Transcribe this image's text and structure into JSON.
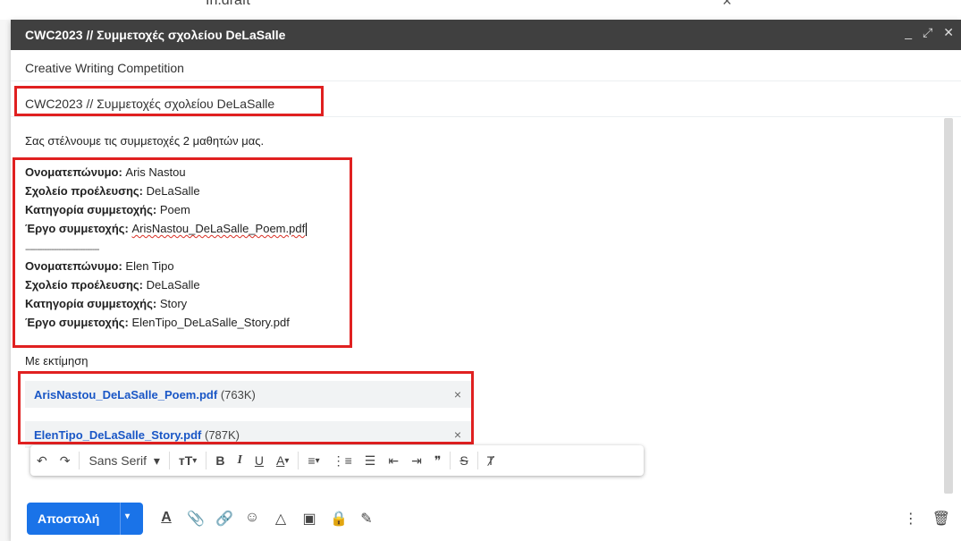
{
  "topstrip": {
    "fragment": "In.draft"
  },
  "window": {
    "title": "CWC2023 // Συμμετοχές σχολείου DeLaSalle",
    "minimize": "_",
    "expand": "⤢",
    "close": "✕"
  },
  "recipient": "Creative Writing Competition",
  "subject": "CWC2023 // Συμμετοχές σχολείου DeLaSalle",
  "body": {
    "intro": "Σας στέλνουμε τις συμμετοχές 2 μαθητών μας.",
    "entries": [
      {
        "name_label": "Ονοματεπώνυμο:",
        "name": "Aris Nastou",
        "school_label": "Σχολείο προέλευσης:",
        "school": "DeLaSalle",
        "category_label": "Κατηγορία συμμετοχής:",
        "category": "Poem",
        "work_label": "Έργο συμμετοχής:",
        "work": "ArisNastou_DeLaSalle_Poem.pdf"
      },
      {
        "name_label": "Ονοματεπώνυμο:",
        "name": "Elen Tipo",
        "school_label": "Σχολείο προέλευσης:",
        "school": "DeLaSalle",
        "category_label": "Κατηγορία συμμετοχής:",
        "category": "Story",
        "work_label": "Έργο συμμετοχής:",
        "work": "ElenTipo_DeLaSalle_Story.pdf"
      }
    ],
    "separator": "-------------------------------",
    "closing": "Με εκτίμηση"
  },
  "attachments": [
    {
      "name": "ArisNastou_DeLaSalle_Poem.pdf",
      "size": "(763K)",
      "remove": "×"
    },
    {
      "name": "ElenTipo_DeLaSalle_Story.pdf",
      "size": "(787K)",
      "remove": "×"
    }
  ],
  "toolbar": {
    "undo": "↶",
    "redo": "↷",
    "font": "Sans Serif",
    "font_caret": "▾",
    "size": "ᴛT",
    "bold": "B",
    "italic": "I",
    "underline": "U",
    "text_color": "A",
    "align": "≡",
    "numbered": "⋮≡",
    "bulleted": "☰",
    "indent_less": "⇤",
    "indent_more": "⇥",
    "quote": "❞",
    "strike": "S",
    "clear": "Ⱦ"
  },
  "send": {
    "label": "Αποστολή",
    "caret": "▾"
  },
  "bottom_icons": [
    "A",
    "📎",
    "🔗",
    "☺",
    "△",
    "▣",
    "🔒",
    "✎"
  ],
  "bottom_right": {
    "more": "⋮",
    "delete": "🗑"
  }
}
